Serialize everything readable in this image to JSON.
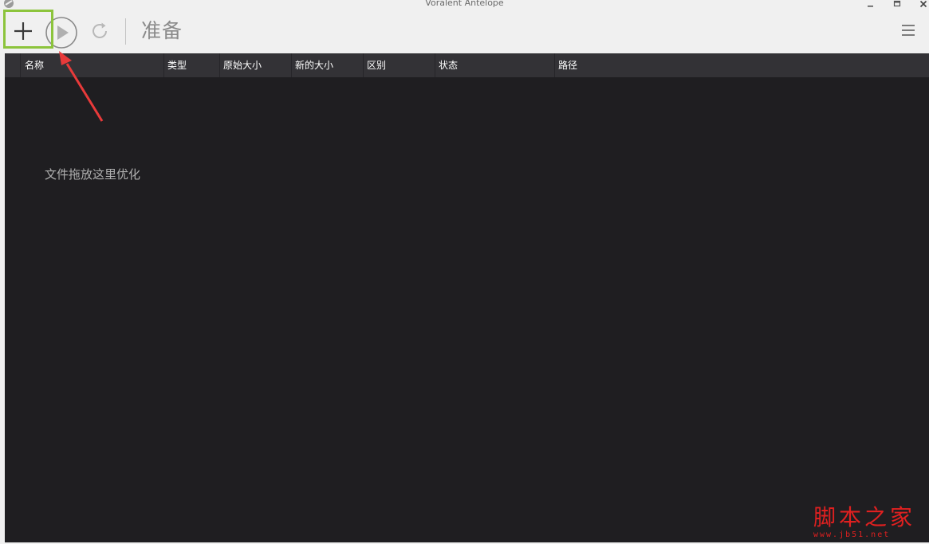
{
  "window": {
    "title": "Voralent Antelope"
  },
  "toolbar": {
    "status": "准备",
    "icons": {
      "add": "plus-icon",
      "start": "play-icon",
      "refresh": "refresh-icon",
      "menu": "hamburger-menu-icon"
    }
  },
  "list": {
    "columns": [
      "名称",
      "类型",
      "原始大小",
      "新的大小",
      "区别",
      "状态",
      "路径"
    ],
    "empty_hint": "文件拖放这里优化"
  },
  "watermark": {
    "chars": "脚本之家",
    "url": "www.jb51.net"
  },
  "colors": {
    "highlight": "#8cc43c",
    "arrow": "#e83a3a",
    "list_bg": "#1f1e21",
    "header_bg": "#333236"
  }
}
